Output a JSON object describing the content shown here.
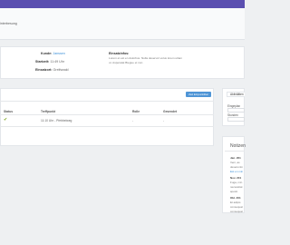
{
  "breadcrumb": "interbesung",
  "info": {
    "customer_label": "Kunde:",
    "customer_value": "Janssen",
    "start_label": "Startzeit:",
    "start_value": "11:49 Uhr",
    "location_label": "Einsatzort:",
    "location_value": "Greifswald",
    "note_label": "Einsatzinfos:",
    "note_text": "Lorem et est en dolorbus. Nulla deserunt volus lorem utlam ut. Asperatat Biegue et non"
  },
  "table": {
    "add_button": "Zeit Einpunktbar",
    "headers": {
      "status": "Status",
      "point": "Treffpunkt",
      "role": "Rolle",
      "sent": "Gesendet"
    },
    "row": {
      "status_icon": "check",
      "point": "11:10 Uhr - Pfebbelweg",
      "role": "-",
      "sent": "-"
    }
  },
  "side": {
    "tab": "Aktivitäten",
    "field1_label": "Eingeplan",
    "field2_label": "Stunden"
  },
  "notes": {
    "title": "Notizen",
    "entries": [
      {
        "date": "Jan. 201",
        "lines": [
          "Veni, as",
          "deseruntm",
          "Est en min"
        ]
      },
      {
        "date": "Nov. 201",
        "lines": [
          "Fuga, min",
          "necessitat",
          "aposit."
        ]
      },
      {
        "date": "Okt. 201",
        "lines": [
          "Et adipis",
          "consequat",
          "consequat"
        ]
      }
    ]
  },
  "colors": {
    "topbar": "#5b4fb0",
    "accent": "#4f95d6",
    "check": "#7aa21b"
  }
}
